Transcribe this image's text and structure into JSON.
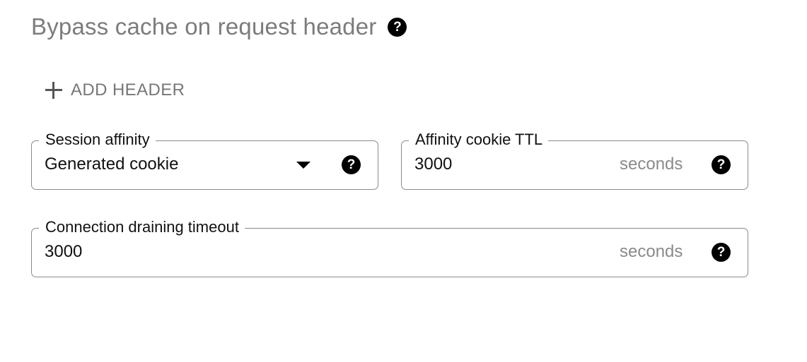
{
  "bypass_cache": {
    "title": "Bypass cache on request header",
    "help_icon": "question-circle-icon",
    "add_header_label": "ADD HEADER",
    "add_icon": "plus-icon"
  },
  "session_affinity": {
    "label": "Session affinity",
    "value": "Generated cookie",
    "dropdown_icon": "triangle-down-icon",
    "help_icon": "question-circle-icon"
  },
  "affinity_cookie_ttl": {
    "label": "Affinity cookie TTL",
    "value": "3000",
    "suffix": "seconds",
    "help_icon": "question-circle-icon"
  },
  "connection_draining_timeout": {
    "label": "Connection draining timeout",
    "value": "3000",
    "suffix": "seconds",
    "help_icon": "question-circle-icon"
  },
  "colors": {
    "border": "#8a8a8a",
    "title": "#7c7c7c",
    "text": "#111111",
    "icon": "#000000"
  }
}
